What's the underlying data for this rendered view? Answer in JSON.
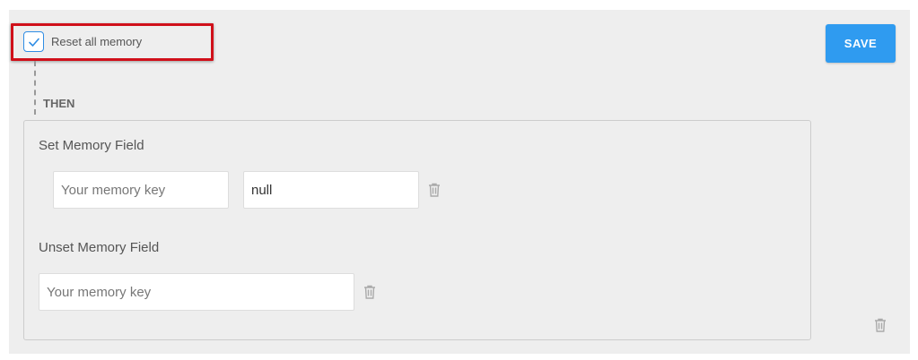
{
  "reset": {
    "label": "Reset all memory",
    "checked": true
  },
  "toolbar": {
    "save_label": "SAVE"
  },
  "flow": {
    "then_label": "THEN"
  },
  "set_memory": {
    "title": "Set Memory Field",
    "key_placeholder": "Your memory key",
    "value": "null"
  },
  "unset_memory": {
    "title": "Unset Memory Field",
    "key_placeholder": "Your memory key"
  },
  "colors": {
    "accent": "#2f9bf0",
    "highlight": "#d0101a",
    "panel": "#eeeeee"
  },
  "icons": {
    "checkbox": "check-icon",
    "delete": "trash-icon"
  }
}
